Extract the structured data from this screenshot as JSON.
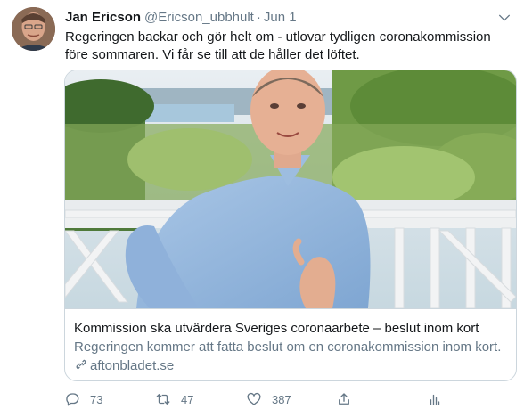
{
  "tweet": {
    "author_name": "Jan Ericson",
    "author_handle": "@Ericson_ubbhult",
    "separator": "·",
    "date": "Jun 1",
    "text": "Regeringen backar och gör helt om - utlovar tydligen coronakommission före sommaren. Vi får se till att de håller det löftet."
  },
  "card": {
    "title": "Kommission ska utvärdera Sveriges coronaarbete – beslut inom kort",
    "description": "Regeringen kommer att fatta beslut om en coronakommission inom kort.",
    "domain": "aftonbladet.se"
  },
  "actions": {
    "replies": "73",
    "retweets": "47",
    "likes": "387"
  },
  "icons": {
    "reply": "reply-icon",
    "retweet": "retweet-icon",
    "like": "heart-icon",
    "share": "share-icon",
    "analytics": "analytics-icon",
    "more": "chevron-down-icon",
    "link": "link-icon"
  },
  "colors": {
    "text": "#14171a",
    "secondary": "#657786",
    "border": "#ccd6dd"
  }
}
